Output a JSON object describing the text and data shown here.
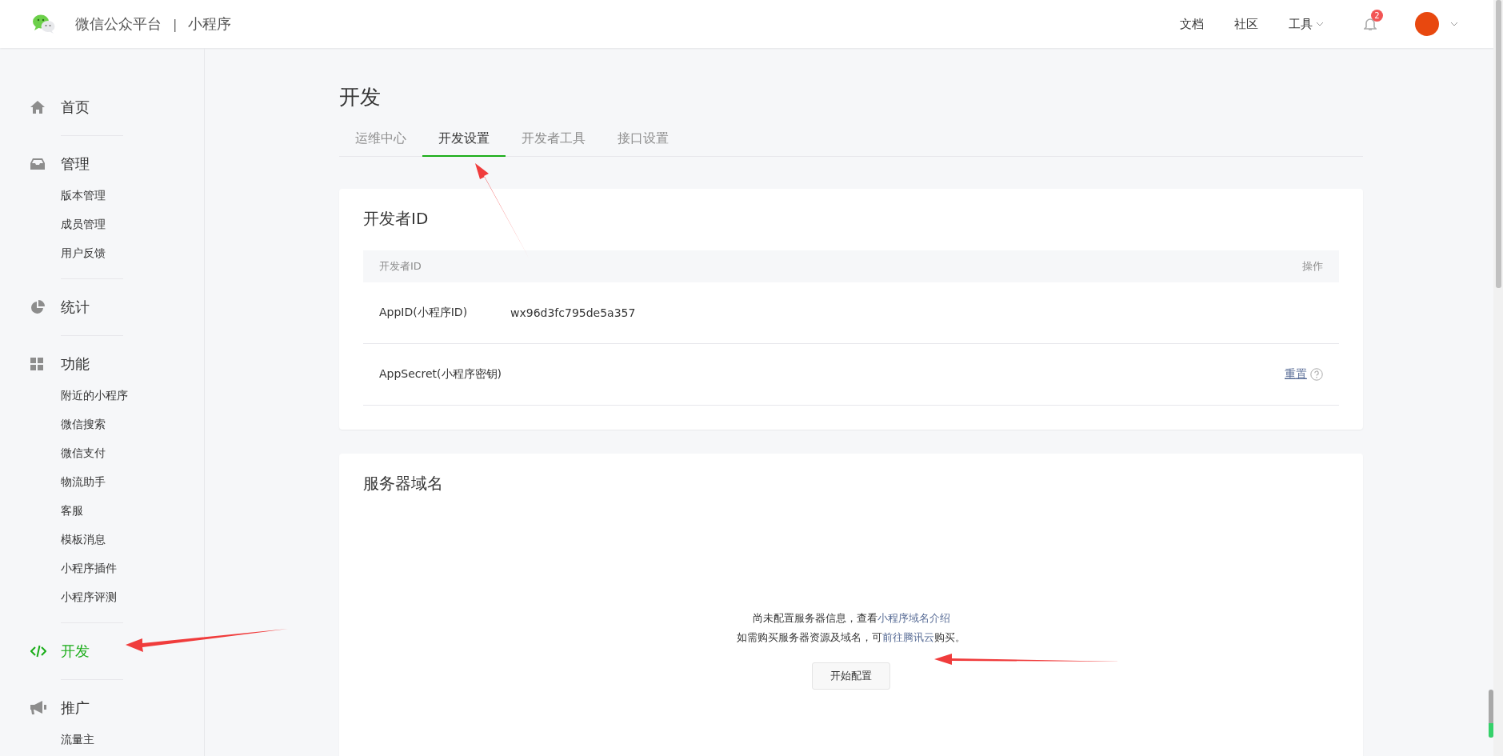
{
  "header": {
    "brand": "微信公众平台",
    "separator": "|",
    "product": "小程序",
    "nav": [
      {
        "label": "文档",
        "kind": "link"
      },
      {
        "label": "社区",
        "kind": "link"
      },
      {
        "label": "工具",
        "kind": "dropdown"
      }
    ],
    "notification_count": "2"
  },
  "sidebar": {
    "items": [
      {
        "label": "首页",
        "selected": false
      },
      {
        "label": "管理",
        "selected": false,
        "children": [
          {
            "label": "版本管理",
            "selected": false
          },
          {
            "label": "成员管理",
            "selected": false
          },
          {
            "label": "用户反馈",
            "selected": false
          }
        ]
      },
      {
        "label": "统计",
        "selected": false
      },
      {
        "label": "功能",
        "selected": false,
        "children": [
          {
            "label": "附近的小程序",
            "selected": false
          },
          {
            "label": "微信搜索",
            "selected": false
          },
          {
            "label": "微信支付",
            "selected": false
          },
          {
            "label": "物流助手",
            "selected": false
          },
          {
            "label": "客服",
            "selected": false
          },
          {
            "label": "模板消息",
            "selected": false
          },
          {
            "label": "小程序插件",
            "selected": false
          },
          {
            "label": "小程序评测",
            "selected": false
          }
        ]
      },
      {
        "label": "开发",
        "selected": true
      },
      {
        "label": "推广",
        "selected": false,
        "children": [
          {
            "label": "流量主",
            "selected": false
          }
        ]
      }
    ]
  },
  "page": {
    "title": "开发",
    "tabs": [
      {
        "label": "运维中心",
        "selected": false
      },
      {
        "label": "开发设置",
        "selected": true
      },
      {
        "label": "开发者工具",
        "selected": false
      },
      {
        "label": "接口设置",
        "selected": false
      }
    ]
  },
  "developer_id": {
    "title": "开发者ID",
    "table": {
      "columns": [
        "开发者ID",
        "操作"
      ],
      "rows": [
        {
          "name": "AppID(小程序ID)",
          "value": "wx96d3fc795de5a357"
        },
        {
          "name": "AppSecret(小程序密钥)",
          "action": "重置"
        }
      ]
    }
  },
  "server_domain": {
    "title": "服务器域名",
    "lines": [
      {
        "text": "尚未配置服务器信息，查看",
        "link": "小程序域名介绍"
      },
      {
        "text": "如需购买服务器资源及域名，可",
        "link": "前往腾讯云",
        "after": "购买。"
      }
    ],
    "button": "开始配置"
  }
}
